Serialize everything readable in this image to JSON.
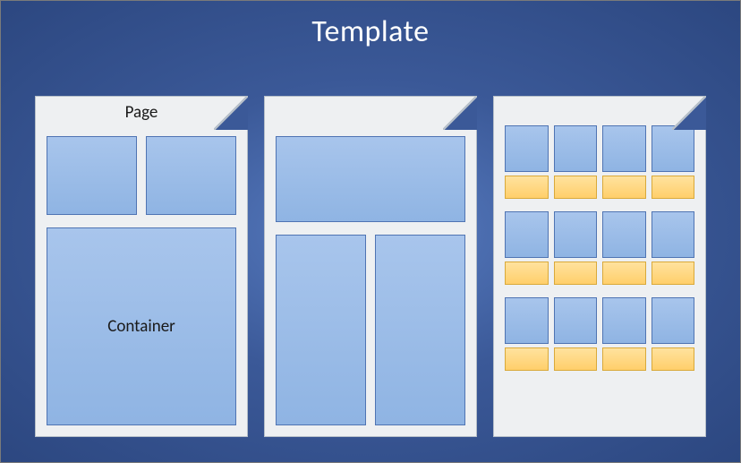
{
  "title": "Template",
  "labels": {
    "page": "Page",
    "container": "Container"
  }
}
